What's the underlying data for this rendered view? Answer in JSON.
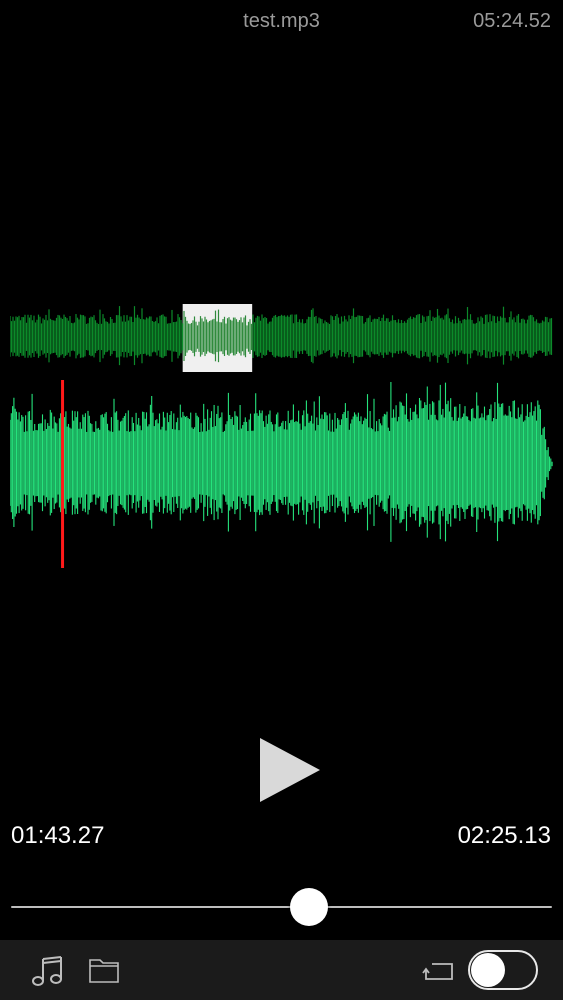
{
  "header": {
    "file_name": "test.mp3",
    "total_duration": "05:24.52"
  },
  "waveform": {
    "overview_color": "#0c8a2a",
    "detail_color": "#25e37c",
    "selection_color": "#f0f0f0",
    "playhead_color": "#ff1a1a",
    "selection_start_fraction": 0.318,
    "selection_end_fraction": 0.446,
    "playhead_fraction": 0.094
  },
  "transport": {
    "play_icon": "play-icon",
    "current_time": "01:43.27",
    "remaining_time": "02:25.13",
    "progress_fraction": 0.551
  },
  "toolbar": {
    "music_icon": "music-note-icon",
    "folder_icon": "folder-icon",
    "loop_icon": "loop-icon",
    "toggle_on": false
  }
}
